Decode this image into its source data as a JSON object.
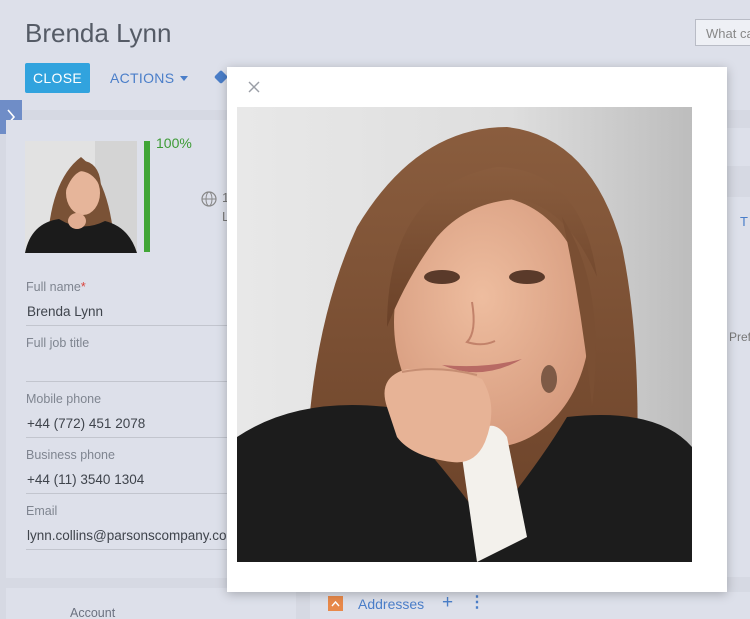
{
  "header": {
    "title": "Brenda Lynn",
    "search_placeholder": "What ca",
    "close_label": "CLOSE",
    "actions_label": "ACTIONS"
  },
  "profile": {
    "completeness": "100%",
    "completeness_value": 100,
    "globe_line1": "1",
    "globe_line2": "L"
  },
  "fields": {
    "full_name_label": "Full name",
    "required_mark": "*",
    "full_name_value": "Brenda Lynn",
    "job_title_label": "Full job title",
    "job_title_value": "",
    "mobile_label": "Mobile phone",
    "mobile_value": "+44 (772) 451 2078",
    "business_label": "Business phone",
    "business_value": "+44 (11) 3540 1304",
    "email_label": "Email",
    "email_value": "lynn.collins@parsonscompany.co"
  },
  "account_label": "Account",
  "right": {
    "tab_fragment": "T",
    "snippet": "Pref",
    "addresses_label": "Addresses",
    "add_symbol": "+",
    "more_symbol": "⋮"
  },
  "colors": {
    "accent": "#31a3de",
    "link": "#4a7ec9",
    "progress": "#41a637",
    "addresses_icon": "#e8894a"
  }
}
